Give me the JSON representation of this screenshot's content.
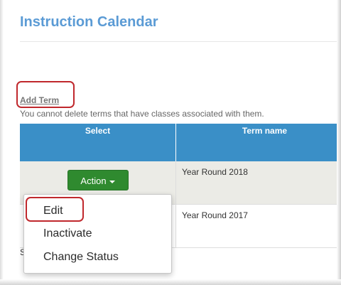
{
  "page": {
    "title": "Instruction Calendar",
    "add_term_link": "Add Term",
    "note": "You cannot delete terms that have classes associated with them.",
    "stub_text": "S"
  },
  "table": {
    "headers": [
      "Select",
      "Term name"
    ],
    "rows": [
      {
        "action_label": "Action",
        "term_name": "Year Round 2018"
      },
      {
        "term_name": "Year Round 2017"
      }
    ]
  },
  "menu": {
    "items": [
      "Edit",
      "Inactivate",
      "Change Status"
    ]
  },
  "colors": {
    "title": "#5b9bd5",
    "header_bg": "#3a8fc7",
    "action_button": "#2f8a2f",
    "highlight_box": "#c0282d",
    "row_alt": "#ebebe6"
  }
}
